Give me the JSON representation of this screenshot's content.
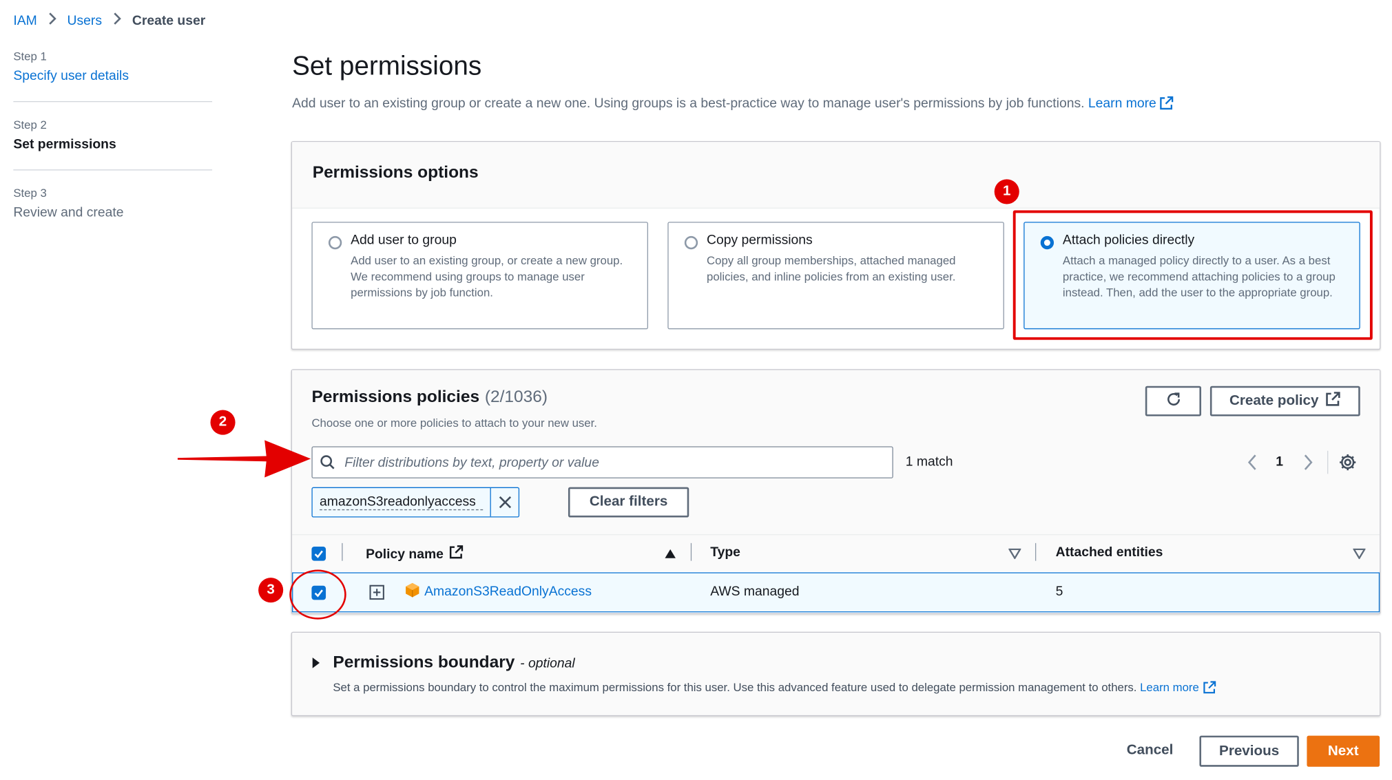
{
  "breadcrumb": {
    "items": [
      "IAM",
      "Users",
      "Create user"
    ]
  },
  "steps": [
    {
      "label": "Step 1",
      "title": "Specify user details"
    },
    {
      "label": "Step 2",
      "title": "Set permissions"
    },
    {
      "label": "Step 3",
      "title": "Review and create"
    }
  ],
  "page": {
    "title": "Set permissions",
    "description": "Add user to an existing group or create a new one. Using groups is a best-practice way to manage user's permissions by job functions.",
    "learn_more": "Learn more"
  },
  "permissions_options": {
    "title": "Permissions options",
    "tiles": [
      {
        "title": "Add user to group",
        "description": "Add user to an existing group, or create a new group. We recommend using groups to manage user permissions by job function.",
        "selected": false
      },
      {
        "title": "Copy permissions",
        "description": "Copy all group memberships, attached managed policies, and inline policies from an existing user.",
        "selected": false
      },
      {
        "title": "Attach policies directly",
        "description": "Attach a managed policy directly to a user. As a best practice, we recommend attaching policies to a group instead. Then, add the user to the appropriate group.",
        "selected": true
      }
    ]
  },
  "policies": {
    "title": "Permissions policies",
    "count": "(2/1036)",
    "description": "Choose one or more policies to attach to your new user.",
    "create_policy": "Create policy",
    "search_placeholder": "Filter distributions by text, property or value",
    "match_text": "1 match",
    "page_number": "1",
    "filter_token": "amazonS3readonlyaccess",
    "clear_filters": "Clear filters",
    "columns": [
      "Policy name",
      "Type",
      "Attached entities"
    ],
    "rows": [
      {
        "name": "AmazonS3ReadOnlyAccess",
        "type": "AWS managed",
        "attached": "5",
        "selected": true
      }
    ]
  },
  "boundary": {
    "title": "Permissions boundary",
    "optional": "- optional",
    "description": "Set a permissions boundary to control the maximum permissions for this user. Use this advanced feature used to delegate permission management to others.",
    "learn_more": "Learn more"
  },
  "footer": {
    "cancel": "Cancel",
    "previous": "Previous",
    "next": "Next"
  },
  "annotations": [
    "1",
    "2",
    "3"
  ],
  "colors": {
    "link": "#0972d3",
    "primary": "#ec7211",
    "annotation": "#e30000"
  }
}
